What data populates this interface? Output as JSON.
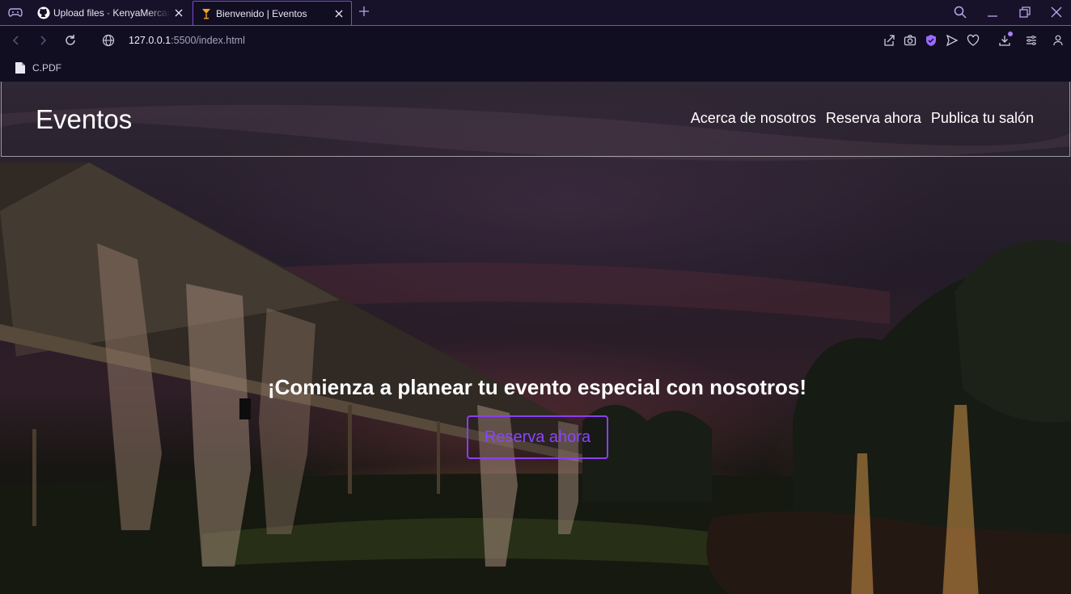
{
  "browser": {
    "tabs": [
      {
        "title": "Upload files · KenyaMercado",
        "active": false
      },
      {
        "title": "Bienvenido | Eventos",
        "active": true
      }
    ],
    "url": {
      "host": "127.0.0.1",
      "rest": ":5500/index.html"
    },
    "bookmarks": [
      {
        "label": "C.PDF"
      }
    ],
    "accent": "#7a4bd4"
  },
  "site": {
    "logo": "Eventos",
    "nav": [
      {
        "label": "Acerca de nosotros"
      },
      {
        "label": "Reserva ahora"
      },
      {
        "label": "Publica tu salón"
      }
    ],
    "hero": {
      "title": "¡Comienza a planear tu evento especial con nosotros!",
      "button": "Reserva ahora",
      "button_color": "#8b45ff"
    }
  }
}
